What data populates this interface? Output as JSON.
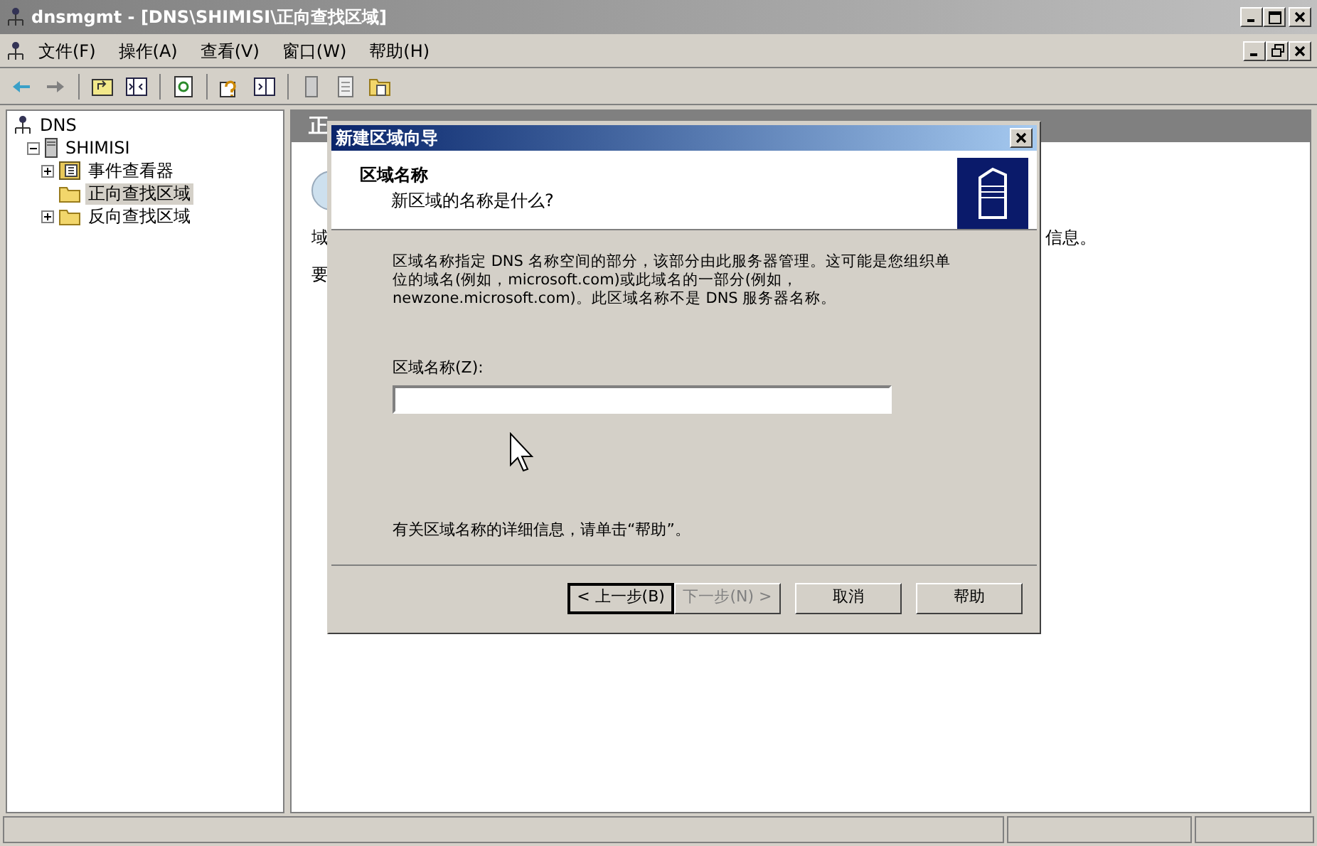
{
  "window": {
    "title": "dnsmgmt - [DNS\\SHIMISI\\正向查找区域]"
  },
  "menu": [
    {
      "label": "文件(F)"
    },
    {
      "label": "操作(A)"
    },
    {
      "label": "查看(V)"
    },
    {
      "label": "窗口(W)"
    },
    {
      "label": "帮助(H)"
    }
  ],
  "tree": [
    {
      "label": "DNS",
      "kind": "root",
      "selected": false,
      "children": [
        {
          "label": "SHIMISI",
          "kind": "server",
          "expanded": true,
          "selected": false,
          "children": [
            {
              "label": "事件查看器",
              "kind": "log",
              "expanded": false,
              "selected": false
            },
            {
              "label": "正向查找区域",
              "kind": "folder",
              "selected": true
            },
            {
              "label": "反向查找区域",
              "kind": "folder",
              "expanded": false,
              "selected": false
            }
          ]
        }
      ]
    }
  ],
  "right_pane": {
    "header": "正",
    "fragments": [
      "域",
      "信息。",
      "要"
    ]
  },
  "dialog": {
    "title": "新建区域向导",
    "heading": "区域名称",
    "subheading": "新区域的名称是什么?",
    "description": "区域名称指定 DNS 名称空间的部分，该部分由此服务器管理。这可能是您组织单位的域名(例如，microsoft.com)或此域名的一部分(例如，newzone.microsoft.com)。此区域名称不是 DNS 服务器名称。",
    "field_label": "区域名称(Z):",
    "help_text": "有关区域名称的详细信息，请单击“帮助”。",
    "buttons": [
      {
        "label": "< 上一步(B)",
        "default": true,
        "disabled": false
      },
      {
        "label": "下一步(N) >",
        "default": false,
        "disabled": true
      },
      {
        "label": "取消",
        "default": false,
        "disabled": false
      },
      {
        "label": "帮助",
        "default": false,
        "disabled": false
      }
    ]
  }
}
